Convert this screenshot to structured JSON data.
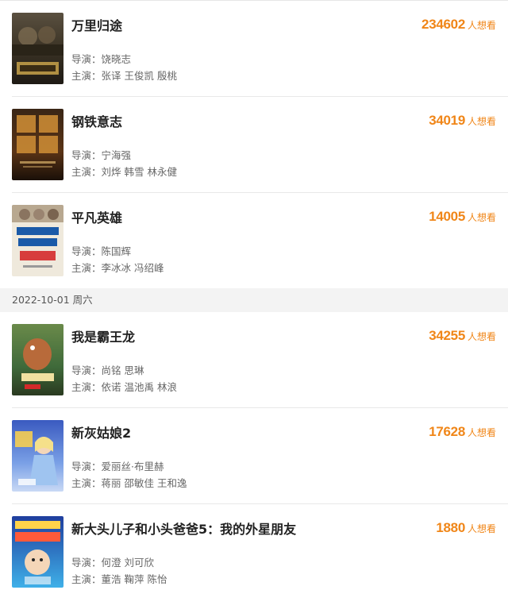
{
  "movies_before": [
    {
      "title": "万里归途",
      "want_count": "234602",
      "want_label": "人想看",
      "director_label": "导演：",
      "director": "饶晓志",
      "cast_label": "主演：",
      "cast": "张译 王俊凯 殷桃",
      "poster_text": "万里归途",
      "poster_colors": [
        "#3b3325",
        "#8a7a55"
      ]
    },
    {
      "title": "钢铁意志",
      "want_count": "34019",
      "want_label": "人想看",
      "director_label": "导演：",
      "director": "宁海强",
      "cast_label": "主演：",
      "cast": "刘烨 韩雪 林永健",
      "poster_text": "意钢 志铁",
      "poster_colors": [
        "#2a1d12",
        "#b5742b"
      ]
    },
    {
      "title": "平凡英雄",
      "want_count": "14005",
      "want_label": "人想看",
      "director_label": "导演：",
      "director": "陈国辉",
      "cast_label": "主演：",
      "cast": "李冰冰 冯绍峰",
      "poster_text": "陆空接力 极限营救",
      "poster_colors": [
        "#e9e2d3",
        "#1a5aa8"
      ]
    }
  ],
  "date_divider": "2022-10-01 周六",
  "movies_after": [
    {
      "title": "我是霸王龙",
      "want_count": "34255",
      "want_label": "人想看",
      "director_label": "导演：",
      "director": "尚铭 思琳",
      "cast_label": "主演：",
      "cast": "依诺 温池禹 林浪",
      "poster_text": "我是霸王龙",
      "poster_colors": [
        "#3f6a3a",
        "#b86a3a"
      ]
    },
    {
      "title": "新灰姑娘2",
      "want_count": "17628",
      "want_label": "人想看",
      "director_label": "导演：",
      "director": "爱丽丝·布里赫",
      "cast_label": "主演：",
      "cast": "蒋丽 邵敏佳 王和逸",
      "poster_text": "经典童话 魔法奇缘",
      "poster_colors": [
        "#4b6fd1",
        "#c9d9f5"
      ]
    },
    {
      "title": "新大头儿子和小头爸爸5：我的外星朋友",
      "want_count": "1880",
      "want_label": "人想看",
      "director_label": "导演：",
      "director": "何澄 刘可欣",
      "cast_label": "主演：",
      "cast": "董浩 鞠萍 陈怡",
      "poster_text": "欢乐太空游 国庆看大头",
      "poster_colors": [
        "#1f3e9e",
        "#3fb0e8"
      ]
    }
  ],
  "colors": {
    "accent": "#f08618",
    "title": "#222222",
    "meta": "#666666",
    "divider_bg": "#f3f3f3"
  }
}
